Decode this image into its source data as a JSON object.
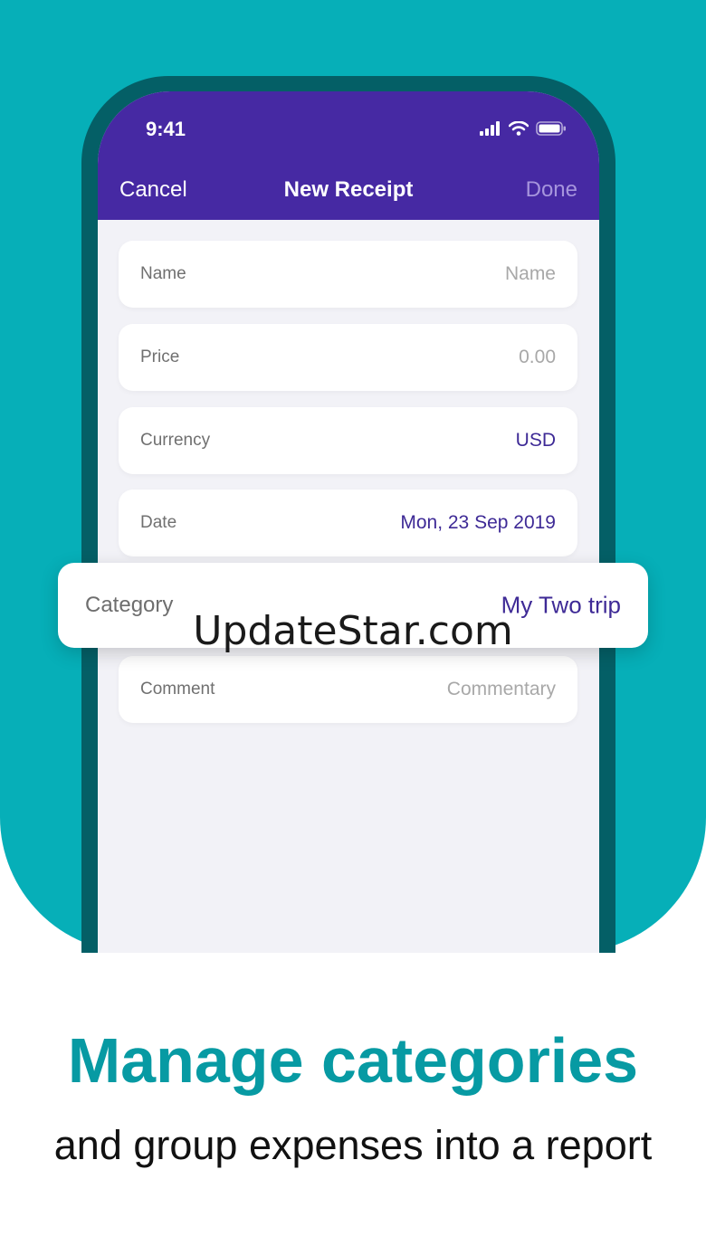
{
  "status_bar": {
    "time": "9:41"
  },
  "nav": {
    "cancel_label": "Cancel",
    "title": "New Receipt",
    "done_label": "Done"
  },
  "form": {
    "name": {
      "label": "Name",
      "placeholder": "Name"
    },
    "price": {
      "label": "Price",
      "placeholder": "0.00"
    },
    "currency": {
      "label": "Currency",
      "value": "USD"
    },
    "date": {
      "label": "Date",
      "value": "Mon, 23 Sep 2019"
    },
    "category": {
      "label": "Category",
      "value": "My Two trip"
    },
    "comment": {
      "label": "Comment",
      "placeholder": "Commentary"
    }
  },
  "watermark": "UpdateStar.com",
  "promo": {
    "headline": "Manage categories",
    "subline": "and group expenses into a report"
  },
  "colors": {
    "background_teal": "#06afb8",
    "header_purple": "#4629a3",
    "accent_text": "#3e2a96",
    "headline_teal": "#079aa3"
  }
}
